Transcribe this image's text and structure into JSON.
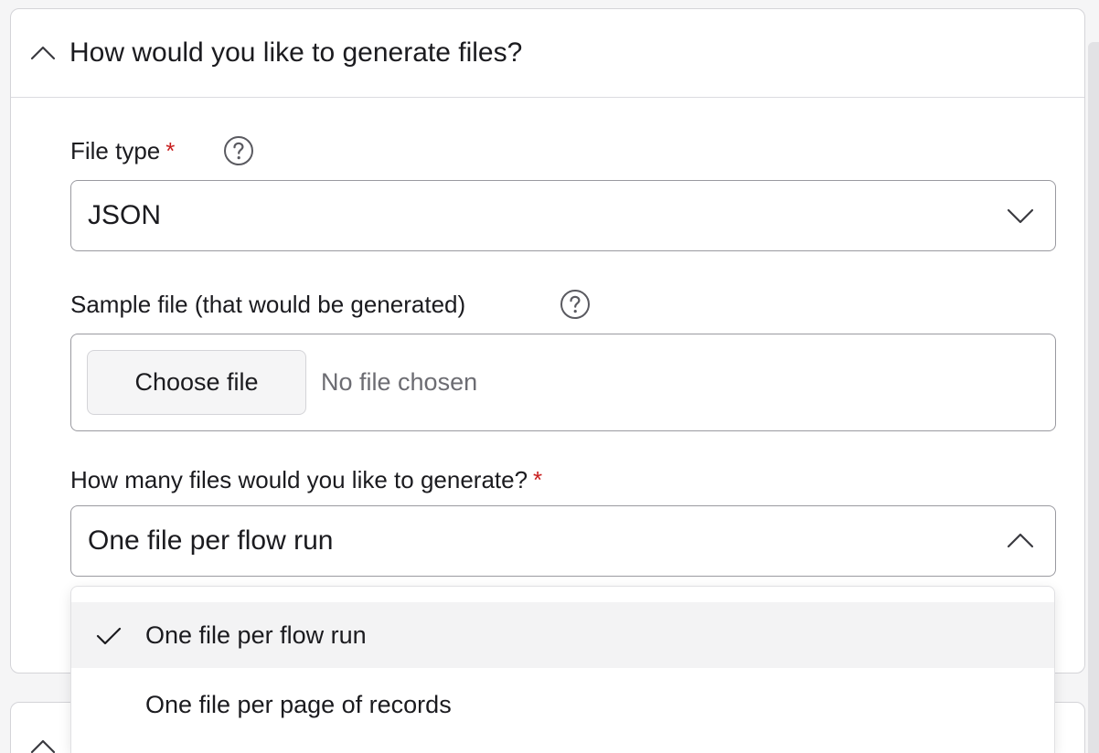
{
  "section": {
    "title": "How would you like to generate files?"
  },
  "file_type": {
    "label": "File type",
    "required_mark": "*",
    "value": "JSON"
  },
  "sample_file": {
    "label": "Sample file (that would be generated)",
    "button_label": "Choose file",
    "status": "No file chosen"
  },
  "files_count": {
    "label": "How many files would you like to generate?",
    "required_mark": "*",
    "value": "One file per flow run",
    "options": [
      {
        "label": "One file per flow run",
        "selected": true
      },
      {
        "label": "One file per page of records",
        "selected": false
      }
    ]
  },
  "colors": {
    "required": "#c81e1e",
    "border": "#9a9aa0",
    "selected_option_bg": "#f3f3f4"
  }
}
